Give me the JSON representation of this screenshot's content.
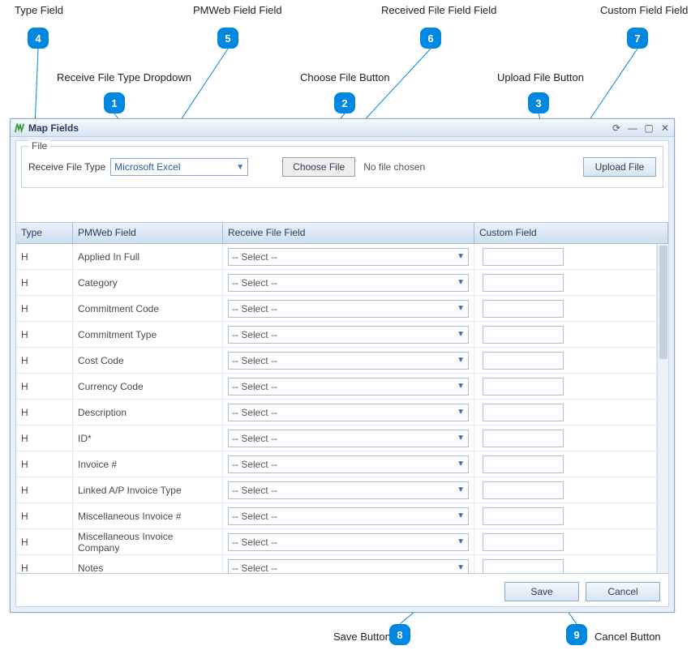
{
  "annotations": {
    "1": "Receive File Type Dropdown",
    "2": "Choose File Button",
    "3": "Upload File Button",
    "4": "Type Field",
    "5": "PMWeb Field Field",
    "6": "Received File Field Field",
    "7": "Custom Field Field",
    "8": "Save Button",
    "9": "Cancel Button"
  },
  "window": {
    "title": "Map Fields"
  },
  "file": {
    "legend": "File",
    "receive_label": "Receive File Type",
    "receive_value": "Microsoft Excel",
    "choose_label": "Choose File",
    "choose_status": "No file chosen",
    "upload_label": "Upload File"
  },
  "grid": {
    "headers": {
      "type": "Type",
      "pmweb": "PMWeb Field",
      "recv": "Receive File Field",
      "custom": "Custom Field"
    },
    "select_placeholder": "-- Select --",
    "rows": [
      {
        "type": "H",
        "pmweb": "Applied In Full"
      },
      {
        "type": "H",
        "pmweb": "Category"
      },
      {
        "type": "H",
        "pmweb": "Commitment Code"
      },
      {
        "type": "H",
        "pmweb": "Commitment Type"
      },
      {
        "type": "H",
        "pmweb": "Cost Code"
      },
      {
        "type": "H",
        "pmweb": "Currency Code"
      },
      {
        "type": "H",
        "pmweb": "Description"
      },
      {
        "type": "H",
        "pmweb": "ID*"
      },
      {
        "type": "H",
        "pmweb": "Invoice #"
      },
      {
        "type": "H",
        "pmweb": "Linked A/P Invoice Type"
      },
      {
        "type": "H",
        "pmweb": "Miscellaneous Invoice #"
      },
      {
        "type": "H",
        "pmweb": "Miscellaneous Invoice Company"
      },
      {
        "type": "H",
        "pmweb": "Notes"
      }
    ]
  },
  "footer": {
    "save": "Save",
    "cancel": "Cancel"
  }
}
